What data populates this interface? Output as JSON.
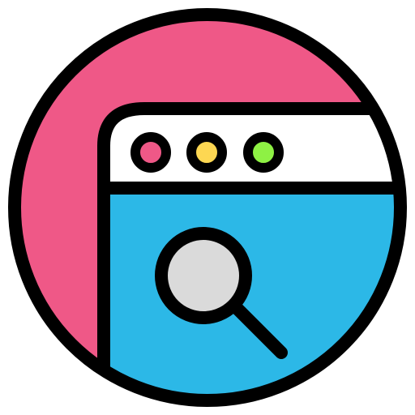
{
  "icon": {
    "name": "browser-search-icon",
    "parts": [
      "circle-badge",
      "browser-window",
      "window-dots",
      "magnifier"
    ]
  },
  "colors": {
    "badge_background": "#EF5887",
    "window_titlebar": "#FFFFFF",
    "window_content": "#2CB8E7",
    "dot_red": "#EF5887",
    "dot_yellow": "#FDD752",
    "dot_green": "#8EF144",
    "magnifier_lens": "#DADADA",
    "outline": "#000000"
  }
}
